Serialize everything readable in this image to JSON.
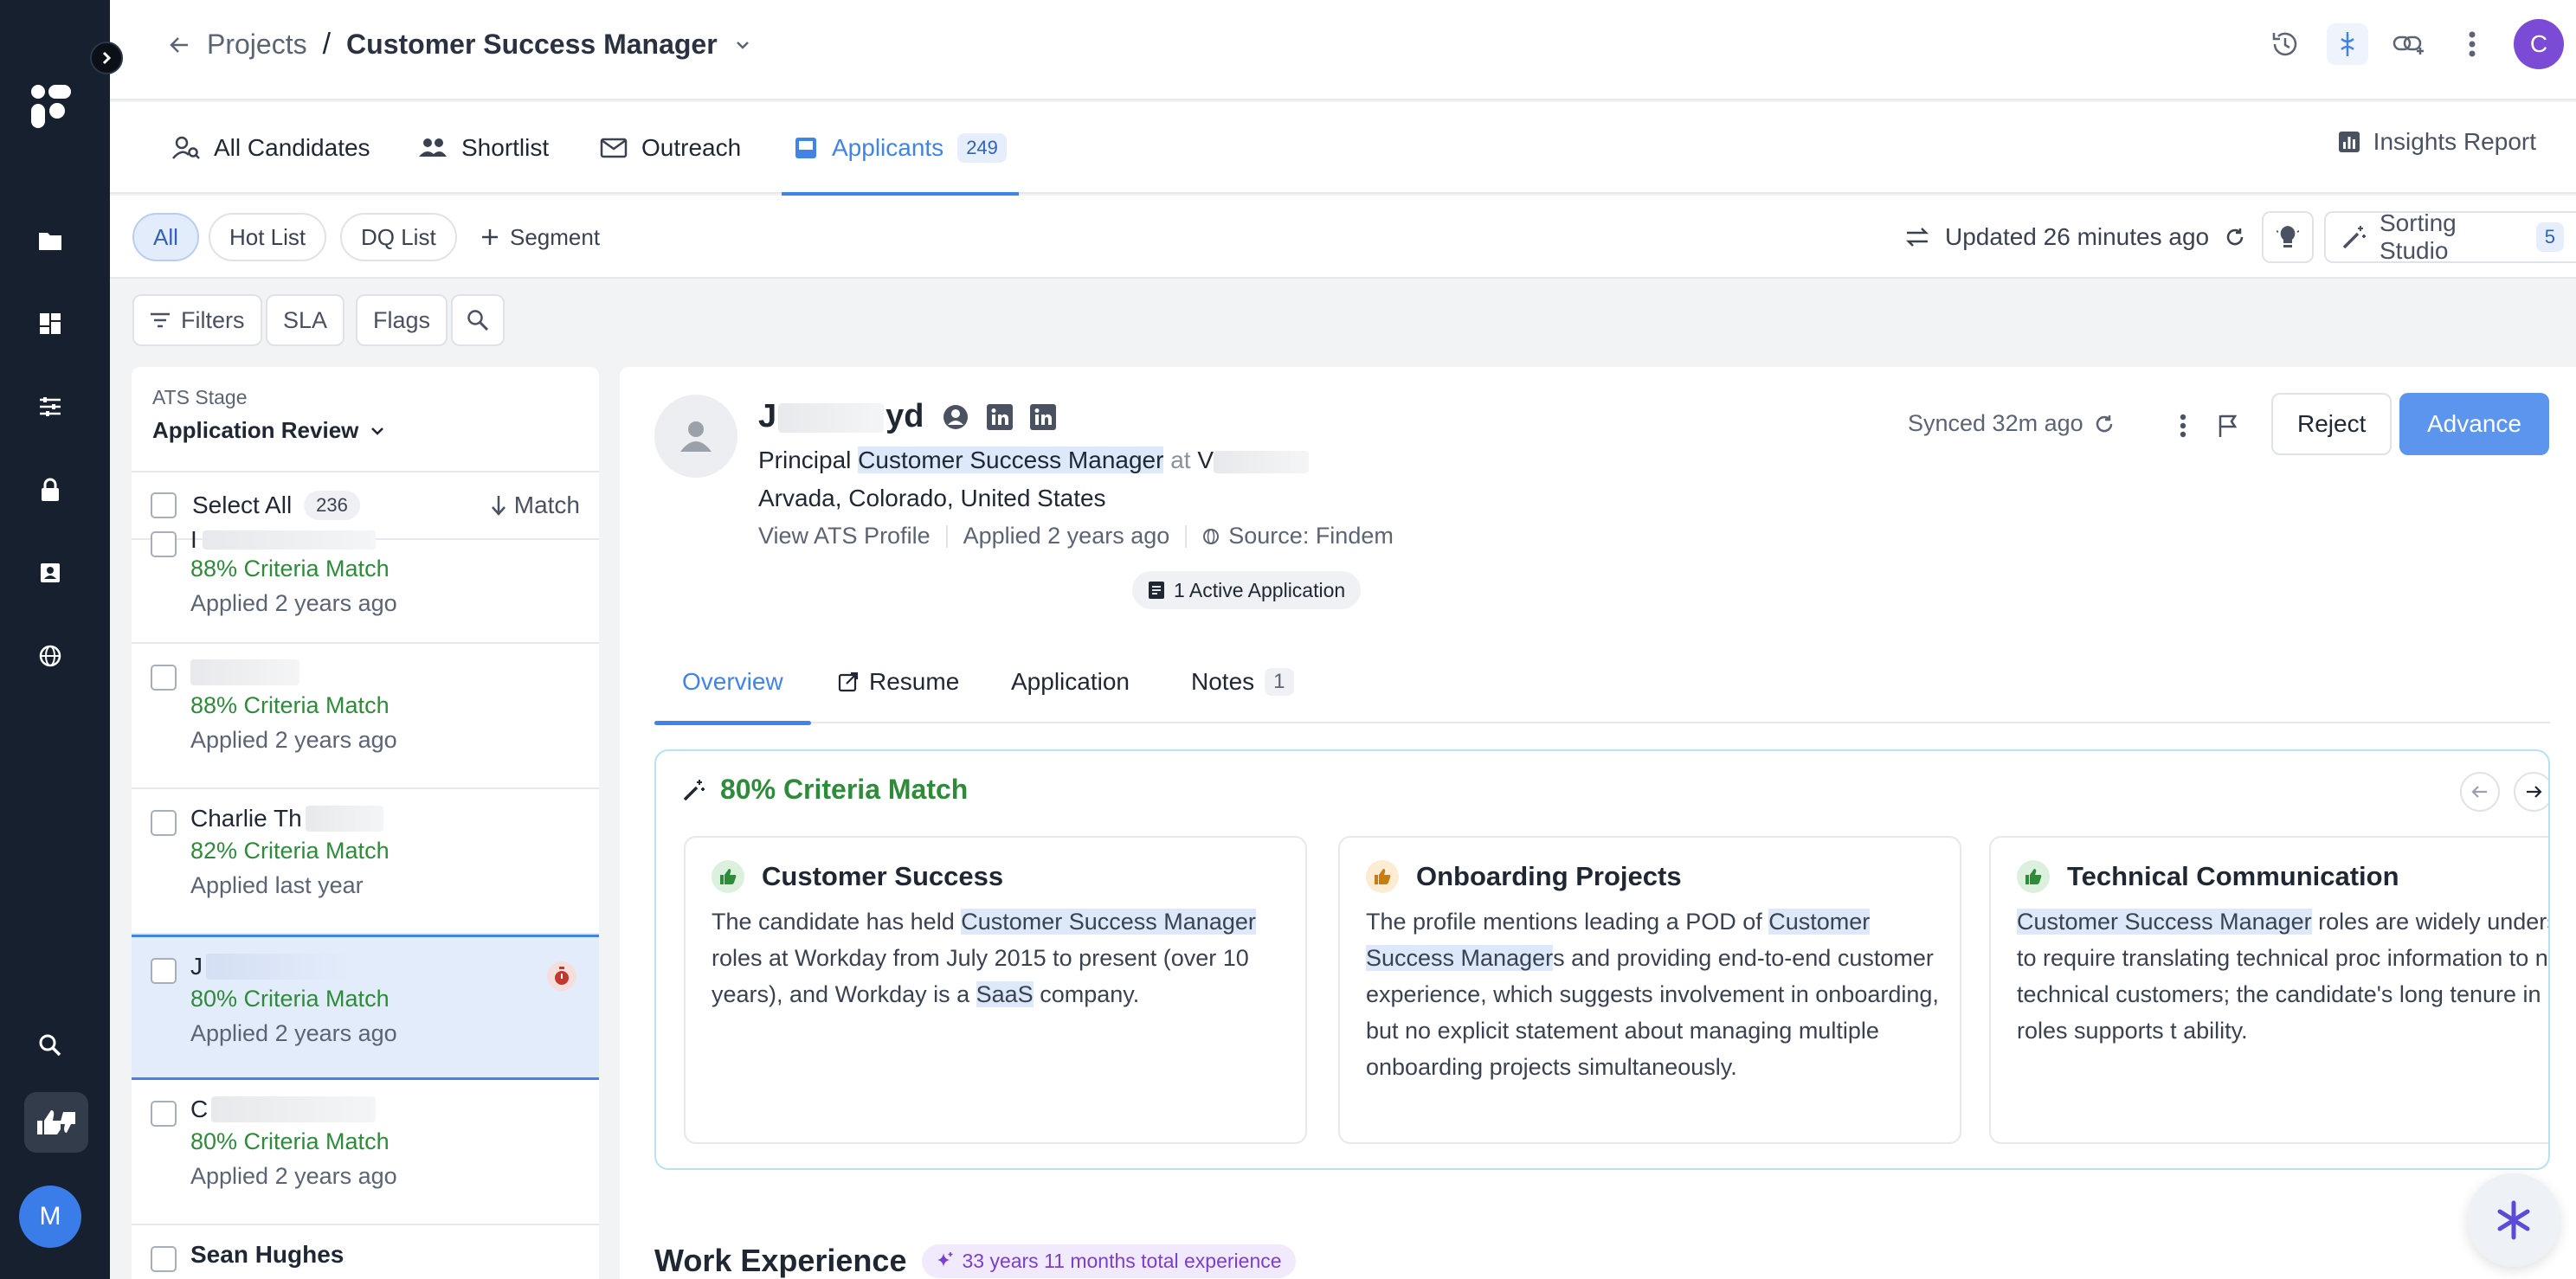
{
  "header": {
    "back_label": "Projects",
    "separator": "/",
    "project_name": "Customer Success Manager",
    "user_initial": "C"
  },
  "rail": {
    "user_initial": "M"
  },
  "tabs": [
    {
      "label": "All Candidates"
    },
    {
      "label": "Shortlist"
    },
    {
      "label": "Outreach"
    },
    {
      "label": "Applicants",
      "count": "249"
    }
  ],
  "insights_label": "Insights Report",
  "segments": {
    "all": "All",
    "hot": "Hot List",
    "dq": "DQ List",
    "add": "Segment",
    "updated": "Updated 26 minutes ago",
    "sorting": "Sorting Studio",
    "sorting_count": "5"
  },
  "filters": {
    "filters": "Filters",
    "sla": "SLA",
    "flags": "Flags"
  },
  "list": {
    "stage_label": "ATS Stage",
    "stage_value": "Application Review",
    "select_all": "Select All",
    "select_count": "236",
    "match_label": "Match",
    "candidates": [
      {
        "name": "I",
        "match": "88% Criteria Match",
        "applied": "Applied 2 years ago"
      },
      {
        "name": "",
        "match": "88% Criteria Match",
        "applied": "Applied 2 years ago"
      },
      {
        "name": "Charlie Th",
        "match": "82% Criteria Match",
        "applied": "Applied last year"
      },
      {
        "name": "J",
        "match": "80% Criteria Match",
        "applied": "Applied 2 years ago"
      },
      {
        "name": "C",
        "match": "80% Criteria Match",
        "applied": "Applied 2 years ago"
      },
      {
        "name": "Sean Hughes",
        "match": "",
        "applied": ""
      }
    ]
  },
  "profile": {
    "name_start": "J",
    "name_end": "yd",
    "title_prefix": "Principal ",
    "title_hl": "Customer Success Manager",
    "title_at": " at ",
    "title_company": "V",
    "location": "Arvada, Colorado, United States",
    "view_ats": "View ATS Profile",
    "applied": "Applied 2 years ago",
    "source": "Source: Findem",
    "active_app": "1 Active Application",
    "synced": "Synced 32m ago",
    "reject": "Reject",
    "advance": "Advance"
  },
  "detail_tabs": [
    {
      "label": "Overview"
    },
    {
      "label": "Resume"
    },
    {
      "label": "Application"
    },
    {
      "label": "Notes",
      "count": "1"
    }
  ],
  "criteria": {
    "title": "80% Criteria Match",
    "cards": [
      {
        "title": "Customer Success",
        "p1": "The candidate has held ",
        "h1": "Customer Success Manager",
        "p2": " roles at Workday from July 2015 to present (over 10 years), and Workday is a ",
        "h2": "SaaS",
        "p3": " company."
      },
      {
        "title": "Onboarding Projects",
        "p1": "The profile mentions leading a POD of ",
        "h1": "Customer Success Manager",
        "p2": "s and providing end-to-end customer experience, which suggests involvement in onboarding, but no explicit statement about managing multiple onboarding projects simultaneously."
      },
      {
        "title": "Technical Communication",
        "h1": "Customer Success Manager",
        "p2": " roles are widely understood to require translating technical proc information to non-technical customers; the candidate's long tenure in such roles supports t ability."
      }
    ]
  },
  "work": {
    "heading": "Work Experience",
    "total": "33 years 11 months total experience"
  },
  "colors": {
    "accent": "#3f84e6",
    "rail": "#16202e",
    "match_green": "#2e8b3a",
    "advance": "#5b95ee"
  }
}
